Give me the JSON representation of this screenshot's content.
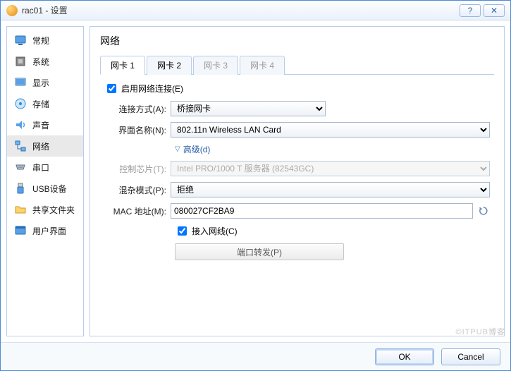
{
  "window_title": "rac01 - 设置",
  "sidebar": {
    "items": [
      {
        "label": "常规"
      },
      {
        "label": "系统"
      },
      {
        "label": "显示"
      },
      {
        "label": "存储"
      },
      {
        "label": "声音"
      },
      {
        "label": "网络"
      },
      {
        "label": "串口"
      },
      {
        "label": "USB设备"
      },
      {
        "label": "共享文件夹"
      },
      {
        "label": "用户界面"
      }
    ],
    "selected_index": 5
  },
  "page": {
    "title": "网络",
    "tabs": [
      {
        "label": "网卡 1",
        "enabled": true
      },
      {
        "label": "网卡 2",
        "enabled": true
      },
      {
        "label": "网卡 3",
        "enabled": false
      },
      {
        "label": "网卡 4",
        "enabled": false
      }
    ],
    "active_tab": 0,
    "enable_adapter": {
      "label": "启用网络连接(E)",
      "checked": true
    },
    "attached_to": {
      "label": "连接方式(A):",
      "value": "桥接网卡"
    },
    "adapter_name": {
      "label": "界面名称(N):",
      "value": "802.11n Wireless LAN Card"
    },
    "advanced_toggle": "高级(d)",
    "adapter_type": {
      "label": "控制芯片(T):",
      "value": "Intel PRO/1000 T 服务器 (82543GC)",
      "disabled": true
    },
    "promiscuous": {
      "label": "混杂模式(P):",
      "value": "拒绝"
    },
    "mac": {
      "label": "MAC 地址(M):",
      "value": "080027CF2BA9"
    },
    "cable_connected": {
      "label": "接入网线(C)",
      "checked": true
    },
    "port_forwarding": "端口转发(P)"
  },
  "buttons": {
    "ok": "OK",
    "cancel": "Cancel"
  },
  "watermark": "©ITPUB博客"
}
